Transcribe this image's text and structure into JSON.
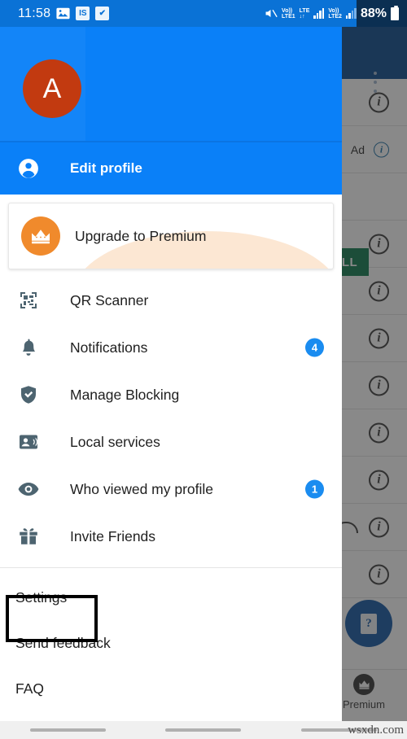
{
  "statusbar": {
    "clock": "11:58",
    "icons": [
      "image-icon",
      "is-badge-icon",
      "checkbox-icon"
    ],
    "mute_icon": "mute-icon",
    "sim1_top": "Vo))",
    "sim1_bottom": "LTE1",
    "lte_top": "LTE",
    "lte_bottom": "↓↑",
    "sim2_top": "Vo))",
    "sim2_bottom": "LTE2",
    "battery_percent": "88%",
    "battery_icon": "battery-icon"
  },
  "drawer": {
    "avatar": {
      "initial": "A",
      "color": "#c23a10"
    },
    "header_color": "#0a80f8",
    "edit_profile": {
      "label": "Edit profile",
      "icon": "account-circle-icon"
    },
    "premium_card": {
      "label": "Upgrade to Premium",
      "icon": "crown-icon",
      "icon_color": "#f08a2c"
    },
    "menu_items": [
      {
        "label": "QR Scanner",
        "icon": "qr-code-icon",
        "badge": ""
      },
      {
        "label": "Notifications",
        "icon": "bell-icon",
        "badge": "4"
      },
      {
        "label": "Manage Blocking",
        "icon": "shield-check-icon",
        "badge": ""
      },
      {
        "label": "Local services",
        "icon": "contact-card-icon",
        "badge": ""
      },
      {
        "label": "Who viewed my profile",
        "icon": "eye-icon",
        "badge": "1"
      },
      {
        "label": "Invite Friends",
        "icon": "gift-icon",
        "badge": ""
      }
    ],
    "secondary_items": [
      {
        "label": "Settings"
      },
      {
        "label": "Send feedback"
      },
      {
        "label": "FAQ"
      }
    ],
    "badge_color": "#1a8cf0"
  },
  "background_app": {
    "overflow_icon": "more-vert-icon",
    "ad_label": "Ad",
    "install_label": "TALL",
    "info_icon": "info-icon",
    "fab_icon": "help-document-icon",
    "fab_glyph": "?",
    "bottom_nav_premium": {
      "label": "Premium",
      "icon": "crown-icon"
    }
  },
  "watermark": "wsxdn.com"
}
